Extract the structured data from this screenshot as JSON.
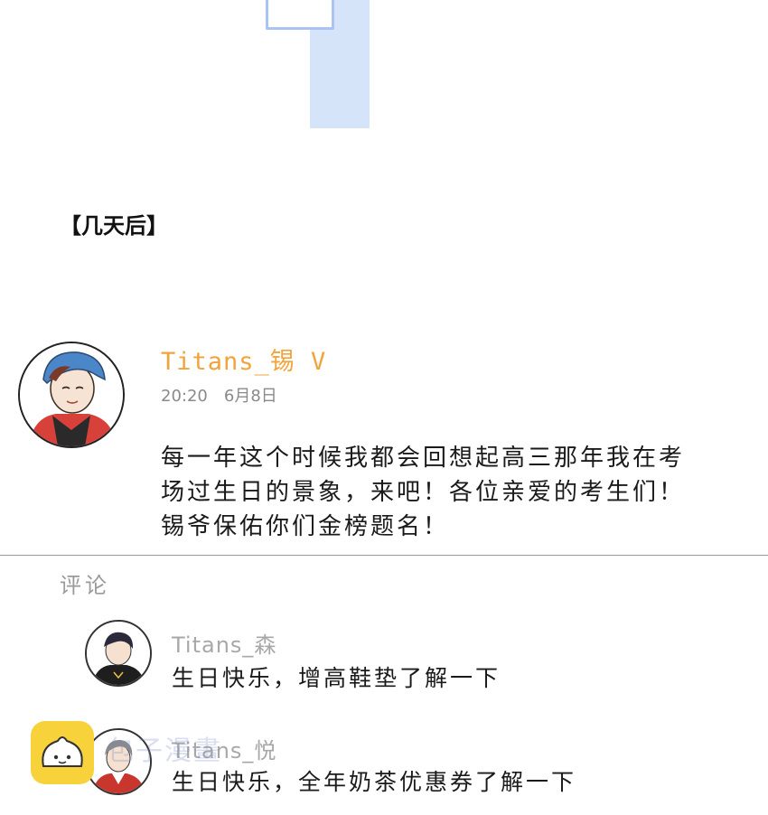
{
  "scene_caption": "【几天后】",
  "post": {
    "username": "Titans_锡 V",
    "time": "20:20",
    "date": "6月8日",
    "body": "每一年这个时候我都会回想起高三那年我在考场过生日的景象，来吧！各位亲爱的考生们！锡爷保佑你们金榜题名！"
  },
  "comments": {
    "label": "评论",
    "items": [
      {
        "name": "Titans_森",
        "text": "生日快乐，增高鞋垫了解一下"
      },
      {
        "name": "Titans_悦",
        "text": "生日快乐，全年奶茶优惠券了解一下"
      }
    ]
  },
  "watermark": {
    "text": "包子漫畫"
  },
  "colors": {
    "username": "#f2a33a",
    "accent_blue": "#a9c4f2",
    "muted": "#9a9a9a"
  }
}
